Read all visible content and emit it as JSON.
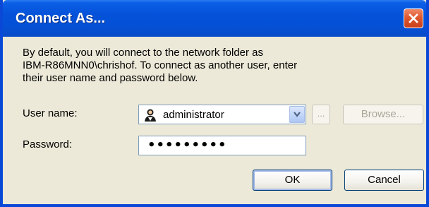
{
  "window": {
    "title": "Connect As..."
  },
  "description": {
    "lines": [
      "By default, you will connect to the network folder as",
      "IBM-R86MNN0\\chrishof. To connect as another user, enter",
      "their user name and password below."
    ]
  },
  "form": {
    "username_label": "User name:",
    "username_value": "administrator",
    "password_label": "Password:",
    "password_value": "•••••••••",
    "ellipsis_label": "...",
    "browse_label": "Browse..."
  },
  "buttons": {
    "ok_label": "OK",
    "cancel_label": "Cancel"
  },
  "colors": {
    "titlebar": "#0552d9",
    "dialog_bg": "#ece9d8",
    "close_button": "#e0582e"
  },
  "icons": {
    "close": "close-icon",
    "user": "user-icon",
    "dropdown": "chevron-down-icon"
  }
}
